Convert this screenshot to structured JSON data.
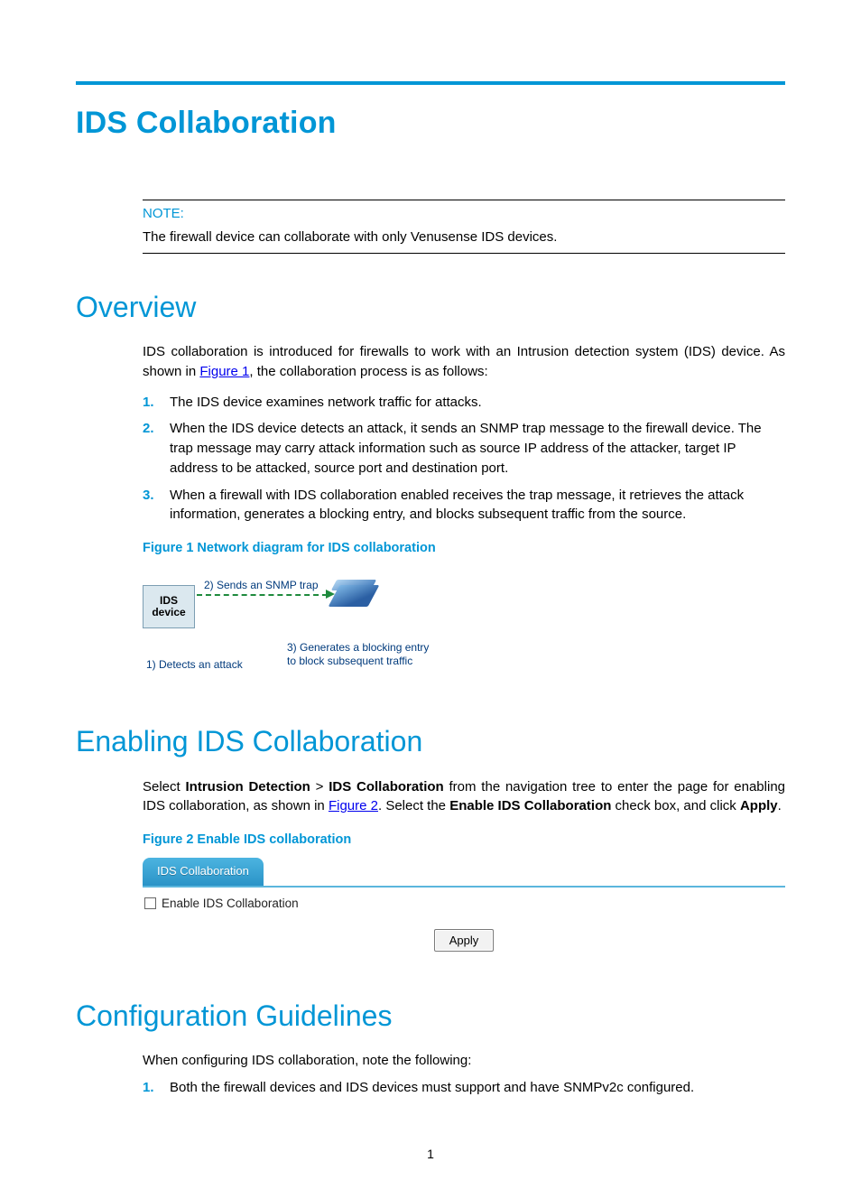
{
  "title": "IDS Collaboration",
  "note": {
    "label": "NOTE:",
    "text": "The firewall device can collaborate with only Venusense IDS devices."
  },
  "section_overview": {
    "heading": "Overview",
    "intro_pre": "IDS collaboration is introduced for firewalls to work with an Intrusion detection system (IDS) device. As shown in ",
    "intro_link": "Figure 1",
    "intro_post": ", the collaboration process is as follows:",
    "steps": [
      "The IDS device examines network traffic for attacks.",
      "When the IDS device detects an attack, it sends an SNMP trap message to the firewall device. The trap message may carry attack information such as source IP address of the attacker, target IP address to be attacked, source port and destination port.",
      "When a firewall with IDS collaboration enabled receives the trap message, it retrieves the attack information, generates a blocking entry, and blocks subsequent traffic from the source."
    ],
    "figure1": {
      "caption": "Figure 1 Network diagram for IDS collaboration",
      "ids_box": "IDS device",
      "snmp_label": "2) Sends an SNMP trap",
      "detect_label": "1) Detects an attack",
      "gen_label": "3) Generates a blocking entry to block subsequent traffic"
    }
  },
  "section_enable": {
    "heading": "Enabling IDS Collaboration",
    "para_pre": "Select ",
    "nav1": "Intrusion Detection",
    "gt": " > ",
    "nav2": "IDS Collaboration",
    "mid1": " from the navigation tree to enter the page for enabling IDS collaboration, as shown in ",
    "fig_link": "Figure 2",
    "mid2": ". Select the ",
    "cb_label_strong": "Enable IDS Collaboration",
    "mid3": " check box, and click ",
    "apply_strong": "Apply",
    "tail": ".",
    "figure2": {
      "caption": "Figure 2 Enable IDS collaboration",
      "tab": "IDS Collaboration",
      "checkbox_label": "Enable IDS Collaboration",
      "apply_button": "Apply"
    }
  },
  "section_guidelines": {
    "heading": "Configuration Guidelines",
    "intro": "When configuring IDS collaboration, note the following:",
    "items": [
      "Both the firewall devices and IDS devices must support and have SNMPv2c configured."
    ]
  },
  "page_number": "1"
}
